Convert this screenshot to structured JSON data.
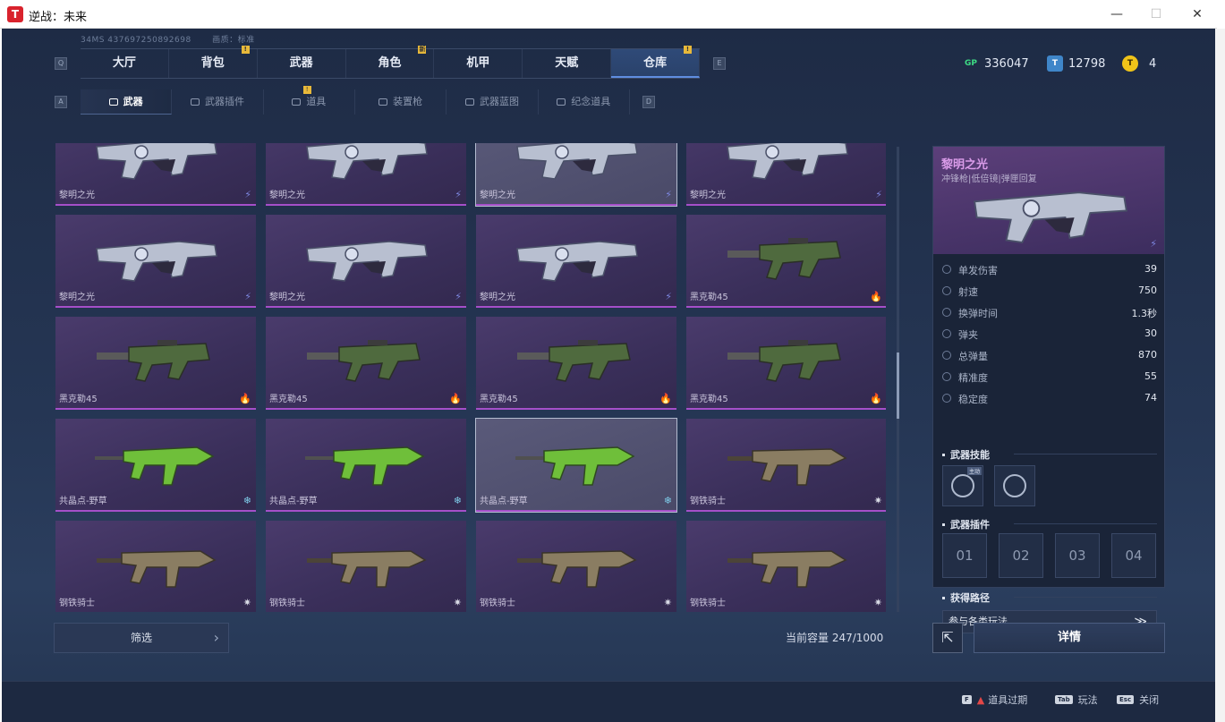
{
  "window": {
    "logo_text": "T",
    "title": "逆战：未来",
    "buttons": {
      "minimize": "—",
      "maximize": "☐",
      "close": "✕"
    }
  },
  "info": {
    "ping": "34MS 437697250892698",
    "quality": "画质：标准"
  },
  "keys": {
    "tab_prev": "Q",
    "tab_next": "E",
    "sub_prev": "A",
    "sub_next": "D"
  },
  "tabs": [
    {
      "label": "大厅",
      "badge": ""
    },
    {
      "label": "背包",
      "badge": "!"
    },
    {
      "label": "武器",
      "badge": ""
    },
    {
      "label": "角色",
      "badge": "新"
    },
    {
      "label": "机甲",
      "badge": ""
    },
    {
      "label": "天赋",
      "badge": ""
    },
    {
      "label": "仓库",
      "badge": "!"
    }
  ],
  "currency": {
    "gp": {
      "icon": "GP",
      "value": "336047"
    },
    "tickets": {
      "icon": "T",
      "value": "12798"
    },
    "coins": {
      "icon": "T",
      "value": "4"
    }
  },
  "subtabs": [
    {
      "label": "武器"
    },
    {
      "label": "武器插件"
    },
    {
      "label": "道具"
    },
    {
      "label": "装置枪"
    },
    {
      "label": "武器蓝图"
    },
    {
      "label": "纪念道具"
    }
  ],
  "items": [
    {
      "name": "黎明之光",
      "icon": "lightning-icon",
      "glyph": "⚡",
      "color": "#7d87e0"
    },
    {
      "name": "黎明之光",
      "icon": "lightning-icon",
      "glyph": "⚡",
      "color": "#7d87e0"
    },
    {
      "name": "黎明之光",
      "icon": "lightning-icon",
      "glyph": "⚡",
      "color": "#7d87e0"
    },
    {
      "name": "黎明之光",
      "icon": "lightning-icon",
      "glyph": "⚡",
      "color": "#7d87e0"
    },
    {
      "name": "黎明之光",
      "icon": "lightning-icon",
      "glyph": "⚡",
      "color": "#7d87e0"
    },
    {
      "name": "黎明之光",
      "icon": "lightning-icon",
      "glyph": "⚡",
      "color": "#7d87e0"
    },
    {
      "name": "黎明之光",
      "icon": "lightning-icon",
      "glyph": "⚡",
      "color": "#7d87e0"
    },
    {
      "name": "黑克勒45",
      "icon": "fire-icon",
      "glyph": "🔥",
      "color": "#f0a020"
    },
    {
      "name": "黑克勒45",
      "icon": "fire-icon",
      "glyph": "🔥",
      "color": "#f0a020"
    },
    {
      "name": "黑克勒45",
      "icon": "fire-icon",
      "glyph": "🔥",
      "color": "#f0a020"
    },
    {
      "name": "黑克勒45",
      "icon": "fire-icon",
      "glyph": "🔥",
      "color": "#f0a020"
    },
    {
      "name": "黑克勒45",
      "icon": "fire-icon",
      "glyph": "🔥",
      "color": "#f0a020"
    },
    {
      "name": "共晶点-野草",
      "icon": "snowflake-icon",
      "glyph": "❄",
      "color": "#7ecbe8"
    },
    {
      "name": "共晶点-野草",
      "icon": "snowflake-icon",
      "glyph": "❄",
      "color": "#7ecbe8"
    },
    {
      "name": "共晶点-野草",
      "icon": "snowflake-icon",
      "glyph": "❄",
      "color": "#7ecbe8"
    },
    {
      "name": "钢铁骑士",
      "icon": "burst-icon",
      "glyph": "✷",
      "color": "#d9dbe6"
    },
    {
      "name": "钢铁骑士",
      "icon": "burst-icon",
      "glyph": "✷",
      "color": "#d9dbe6"
    },
    {
      "name": "钢铁骑士",
      "icon": "burst-icon",
      "glyph": "✷",
      "color": "#d9dbe6"
    },
    {
      "name": "钢铁骑士",
      "icon": "burst-icon",
      "glyph": "✷",
      "color": "#d9dbe6"
    },
    {
      "name": "钢铁骑士",
      "icon": "burst-icon",
      "glyph": "✷",
      "color": "#d9dbe6"
    }
  ],
  "filter_label": "筛选",
  "capacity": "当前容量 247/1000",
  "detail": {
    "name": "黎明之光",
    "subtitle": "冲锋枪|低倍镜|弹匣回复",
    "stats": [
      {
        "label": "单发伤害",
        "value": "39"
      },
      {
        "label": "射速",
        "value": "750"
      },
      {
        "label": "换弹时间",
        "value": "1.3秒"
      },
      {
        "label": "弹夹",
        "value": "30"
      },
      {
        "label": "总弹量",
        "value": "870"
      },
      {
        "label": "精准度",
        "value": "55"
      },
      {
        "label": "稳定度",
        "value": "74"
      }
    ],
    "skills_title": "武器技能",
    "skill_tag": "主动",
    "plugins_title": "武器插件",
    "plugins": [
      "01",
      "02",
      "03",
      "04"
    ],
    "route_title": "获得路径",
    "route_label": "参与各类玩法",
    "route_arrow": "≫"
  },
  "share_glyph": "⇱",
  "details_button": "详情",
  "hints": [
    {
      "key": "F",
      "label": "道具过期"
    },
    {
      "key": "Tab",
      "label": "玩法"
    },
    {
      "key": "Esc",
      "label": "关闭"
    }
  ],
  "colors": {
    "accent": "#5f8de0",
    "rarity_purple": "#a54fc9",
    "gp_green": "#3ddc84",
    "coin_gold": "#f0c419"
  }
}
